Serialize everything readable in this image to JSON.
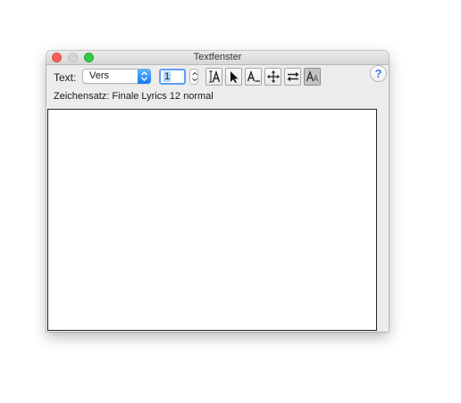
{
  "window": {
    "title": "Textfenster"
  },
  "toolbar": {
    "text_label": "Text:",
    "text_type_selected": "Vers",
    "number_value": "1",
    "tools": [
      {
        "name": "text-cursor-icon"
      },
      {
        "name": "arrow-pointer-icon"
      },
      {
        "name": "text-baseline-icon"
      },
      {
        "name": "move-icon"
      },
      {
        "name": "swap-arrows-icon"
      },
      {
        "name": "font-size-icon",
        "active": true
      }
    ],
    "help_label": "?"
  },
  "charset_line": "Zeichensatz: Finale Lyrics 12 normal",
  "colors": {
    "close": "#fc5f57",
    "zoom": "#34c84a",
    "select_accent": "#0f7bf2",
    "focus_ring": "#5c9ef3",
    "help_text": "#3a7ce6"
  }
}
